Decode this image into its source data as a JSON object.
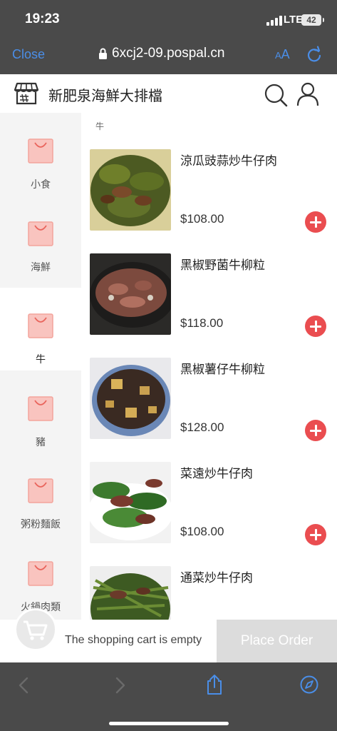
{
  "status": {
    "time": "19:23",
    "network": "LTE",
    "battery": "42"
  },
  "browser": {
    "close_label": "Close",
    "url": "6xcj2-09.pospal.cn",
    "aa_small": "A",
    "aa_large": "A"
  },
  "header": {
    "store_name": "新肥泉海鮮大排檔"
  },
  "sidebar": {
    "items": [
      {
        "label": "小食"
      },
      {
        "label": "海鮮"
      },
      {
        "label": "牛",
        "active": true
      },
      {
        "label": "豬"
      },
      {
        "label": "粥粉麵飯"
      },
      {
        "label": "火鍋肉類"
      }
    ]
  },
  "content": {
    "section_title": "牛",
    "items": [
      {
        "name": "涼瓜豉蒜炒牛仔肉",
        "price": "$108.00"
      },
      {
        "name": "黑椒野菌牛柳粒",
        "price": "$118.00"
      },
      {
        "name": "黑椒薯仔牛柳粒",
        "price": "$128.00"
      },
      {
        "name": "菜遠炒牛仔肉",
        "price": "$108.00"
      },
      {
        "name": "通菜炒牛仔肉",
        "price": ""
      }
    ]
  },
  "cart": {
    "empty_text": "The shopping cart is empty",
    "place_order_label": "Place Order"
  },
  "colors": {
    "accent_red": "#ea4d50",
    "link_blue": "#4a8ee8",
    "bag_pink": "#f9c4bf"
  }
}
